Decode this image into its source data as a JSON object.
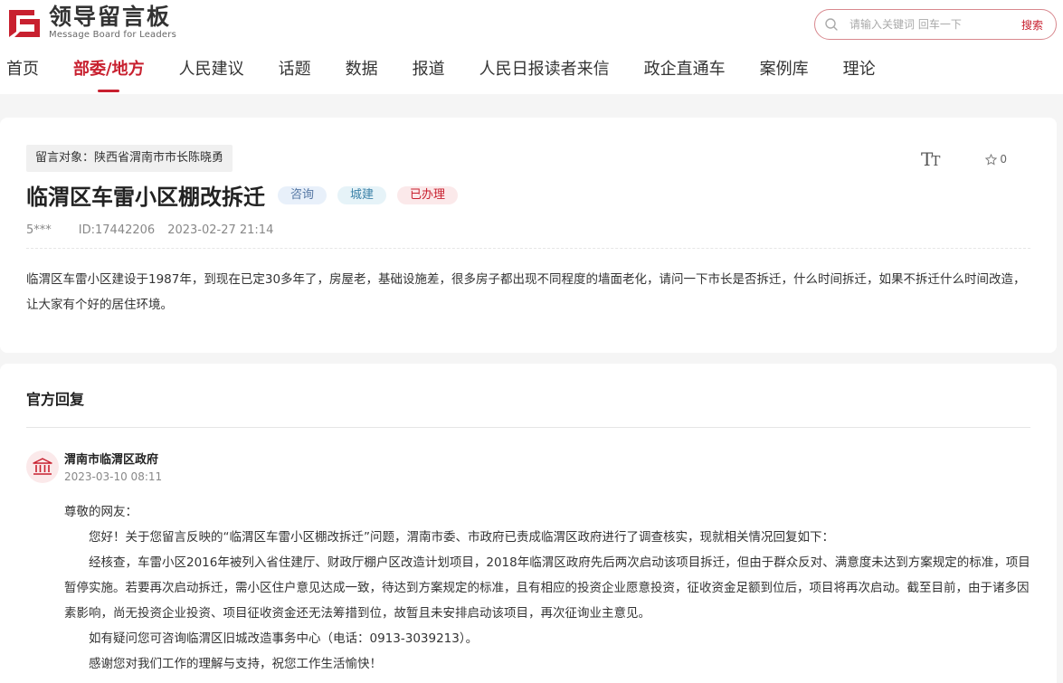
{
  "header": {
    "logo_cn": "领导留言板",
    "logo_en": "Message Board for Leaders",
    "search_placeholder": "请输入关键词 回车一下",
    "search_button": "搜索"
  },
  "nav": {
    "items": [
      "首页",
      "部委/地方",
      "人民建议",
      "话题",
      "数据",
      "报道",
      "人民日报读者来信",
      "政企直通车",
      "案例库",
      "理论"
    ],
    "active_index": 1
  },
  "message": {
    "target": "留言对象：陕西省渭南市市长陈晓勇",
    "title": "临渭区车雷小区棚改拆迁",
    "tags": [
      "咨询",
      "城建",
      "已办理"
    ],
    "font_icon_label": "T",
    "font_icon_label_small": "T",
    "fav_count": "0",
    "author": "5***",
    "id": "ID:17442206",
    "time": "2023-02-27 21:14",
    "content": "临渭区车雷小区建设于1987年，到现在已定30多年了，房屋老，基础设施差，很多房子都出现不同程度的墙面老化，请问一下市长是否拆迁，什么时间拆迁，如果不拆迁什么时间改造，让大家有个好的居住环境。"
  },
  "reply": {
    "section_title": "官方回复",
    "org": "渭南市临渭区政府",
    "time": "2023-03-10 08:11",
    "salutation": "尊敬的网友：",
    "paragraphs": [
      "您好！关于您留言反映的“临渭区车雷小区棚改拆迁”问题，渭南市委、市政府已责成临渭区政府进行了调查核实，现就相关情况回复如下：",
      "经核查，车雷小区2016年被列入省住建厅、财政厅棚户区改造计划项目，2018年临渭区政府先后两次启动该项目拆迁，但由于群众反对、满意度未达到方案规定的标准，项目暂停实施。若要再次启动拆迁，需小区住户意见达成一致，待达到方案规定的标准，且有相应的投资企业愿意投资，征收资金足额到位后，项目将再次启动。截至目前，由于诸多因素影响，尚无投资企业投资、项目征收资金还无法筹措到位，故暂且未安排启动该项目，再次征询业主意见。",
      "如有疑问您可咨询临渭区旧城改造事务中心（电话：0913-3039213）。",
      "感谢您对我们工作的理解与支持，祝您工作生活愉快！"
    ]
  },
  "colors": {
    "accent": "#c8202f",
    "tag_blue_bg": "#e8f0fa",
    "tag_red_bg": "#fbe9ea"
  }
}
